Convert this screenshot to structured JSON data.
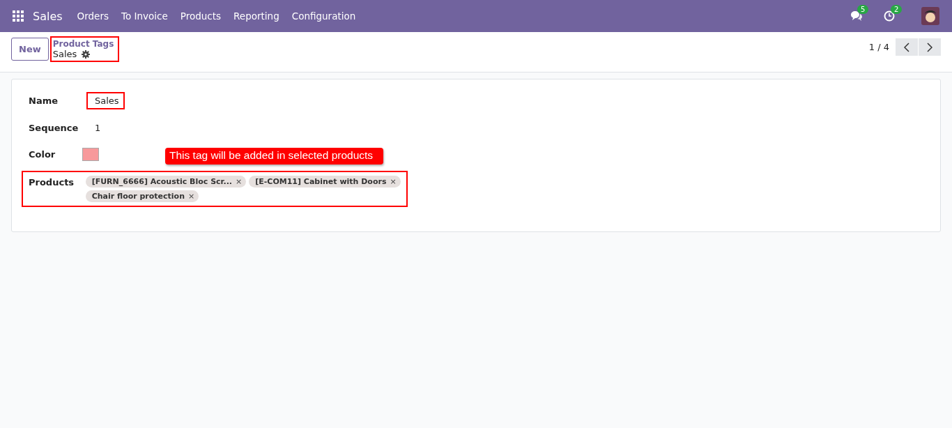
{
  "navbar": {
    "app": "Sales",
    "menu": [
      "Orders",
      "To Invoice",
      "Products",
      "Reporting",
      "Configuration"
    ],
    "messages_count": "5",
    "activities_count": "2"
  },
  "control_panel": {
    "new_button": "New",
    "breadcrumb": "Product Tags",
    "record": "Sales",
    "pager": "1 / 4"
  },
  "form": {
    "fields": [
      {
        "kind": "text",
        "label": "Name",
        "value": "Sales",
        "highlighted": true
      },
      {
        "kind": "text",
        "label": "Sequence",
        "value": "1",
        "highlighted": false
      },
      {
        "kind": "color",
        "label": "Color",
        "color": "#f7999b",
        "highlighted": false
      },
      {
        "kind": "tags",
        "label": "Products",
        "highlighted": true,
        "tags": [
          {
            "label": "[FURN_6666] Acoustic Bloc Scr...",
            "remove": "×"
          },
          {
            "label": "[E-COM11] Cabinet with Doors",
            "remove": "×"
          },
          {
            "label": "Chair floor protection",
            "remove": "×"
          }
        ]
      }
    ],
    "callout": "This tag will be added in selected products"
  }
}
